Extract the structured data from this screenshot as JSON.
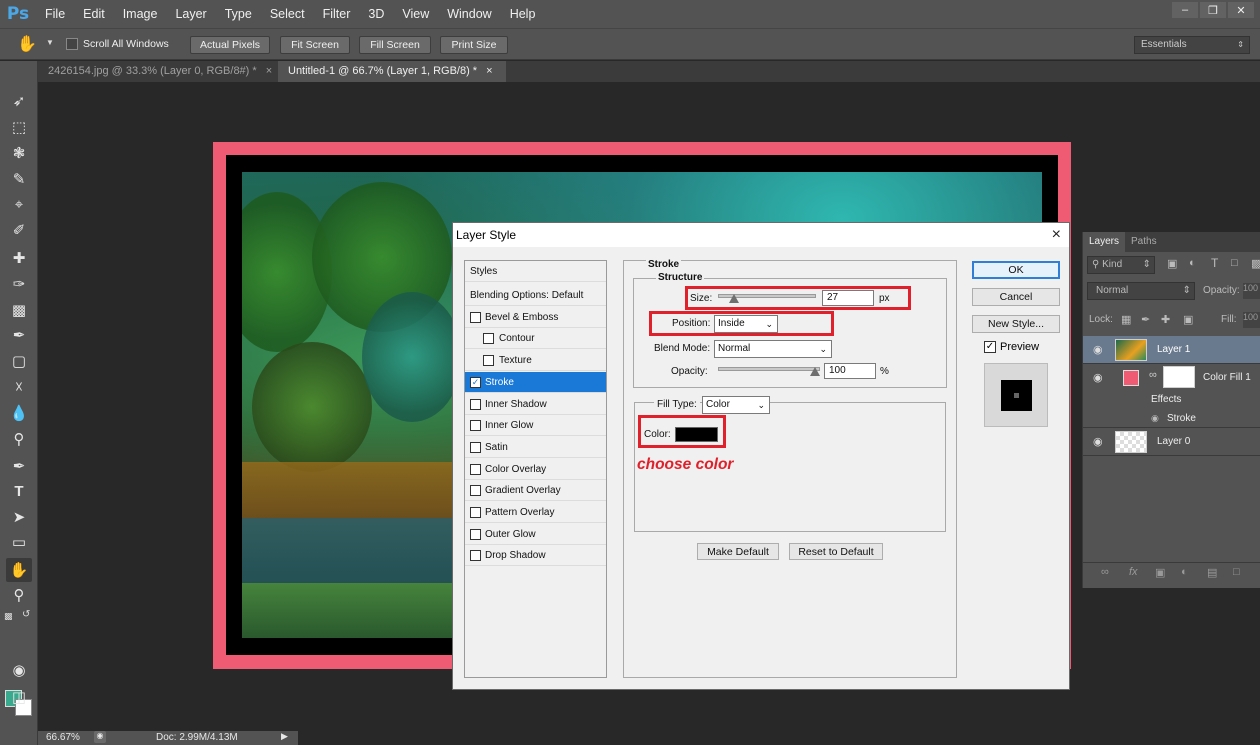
{
  "app": {
    "logo": "Ps",
    "menu": [
      "File",
      "Edit",
      "Image",
      "Layer",
      "Type",
      "Select",
      "Filter",
      "3D",
      "View",
      "Window",
      "Help"
    ]
  },
  "options_bar": {
    "scroll_all_windows": "Scroll All Windows",
    "actual_pixels": "Actual Pixels",
    "fit_screen": "Fit Screen",
    "fill_screen": "Fill Screen",
    "print_size": "Print Size",
    "workspace": "Essentials"
  },
  "tabs": [
    {
      "label": "2426154.jpg @ 33.3% (Layer 0, RGB/8#) *",
      "close": "×"
    },
    {
      "label": "Untitled-1 @ 66.7% (Layer 1, RGB/8) *",
      "close": "×"
    }
  ],
  "status": {
    "zoom": "66.67%",
    "doc": "Doc: 2.99M/4.13M"
  },
  "colors": {
    "foreground": "#3aaa8e",
    "background": "#ffffff",
    "canvas_border": "#ef5b73",
    "annotation": "#e0202a",
    "selection": "#1a78d6"
  },
  "layers_panel": {
    "tabs": [
      "Layers",
      "Paths"
    ],
    "filter": "Kind",
    "blend": "Normal",
    "opacity_label": "Opacity:",
    "opacity_value": "100",
    "lock_label": "Lock:",
    "fill_label": "Fill:",
    "fill_value": "100",
    "layers": [
      {
        "name": "Layer 1"
      },
      {
        "name": "Color Fill 1",
        "effects": "Effects",
        "effect": "Stroke"
      },
      {
        "name": "Layer 0"
      }
    ]
  },
  "dialog": {
    "title": "Layer Style",
    "close": "×",
    "styles_header": "Styles",
    "blending_options": "Blending Options: Default",
    "items": [
      {
        "label": "Bevel & Emboss",
        "checked": false
      },
      {
        "label": "Contour",
        "checked": false,
        "indent": true
      },
      {
        "label": "Texture",
        "checked": false,
        "indent": true
      },
      {
        "label": "Stroke",
        "checked": true
      },
      {
        "label": "Inner Shadow",
        "checked": false
      },
      {
        "label": "Inner Glow",
        "checked": false
      },
      {
        "label": "Satin",
        "checked": false
      },
      {
        "label": "Color Overlay",
        "checked": false
      },
      {
        "label": "Gradient Overlay",
        "checked": false
      },
      {
        "label": "Pattern Overlay",
        "checked": false
      },
      {
        "label": "Outer Glow",
        "checked": false
      },
      {
        "label": "Drop Shadow",
        "checked": false
      }
    ],
    "stroke": {
      "title": "Stroke",
      "structure": "Structure",
      "size_label": "Size:",
      "size_value": "27",
      "size_unit": "px",
      "position_label": "Position:",
      "position_value": "Inside",
      "blend_mode_label": "Blend Mode:",
      "blend_mode_value": "Normal",
      "opacity_label": "Opacity:",
      "opacity_value": "100",
      "opacity_unit": "%",
      "fill_type_label": "Fill Type:",
      "fill_type_value": "Color",
      "color_label": "Color:",
      "make_default": "Make Default",
      "reset_default": "Reset to Default"
    },
    "ok": "OK",
    "cancel": "Cancel",
    "new_style": "New Style...",
    "preview": "Preview",
    "annotation": "choose color"
  }
}
